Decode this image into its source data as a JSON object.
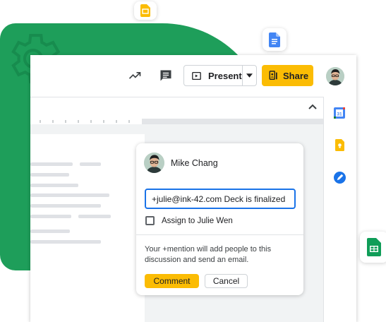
{
  "toolbar": {
    "present_label": "Present",
    "share_label": "Share"
  },
  "comment": {
    "author": "Mike Chang",
    "input_value": "+julie@ink-42.com Deck is finalized",
    "assign_label": "Assign to Julie Wen",
    "assign_checked": false,
    "helper_text": "Your +mention will add people to this discussion and send an email.",
    "comment_button": "Comment",
    "cancel_button": "Cancel"
  },
  "side_panel": {
    "calendar_day": "31",
    "apps": [
      "calendar-icon",
      "keep-icon",
      "tasks-icon"
    ]
  },
  "floating_apps": [
    "slides-icon",
    "docs-icon",
    "sheets-icon"
  ],
  "colors": {
    "accent_yellow": "#fbbc04",
    "brand_green": "#1e9e5a",
    "focus_blue": "#1a73e8"
  },
  "icons": {
    "trend": "trending-up-icon",
    "comments": "comments-icon",
    "present": "present-icon",
    "dropdown": "chevron-down-icon",
    "share": "share-icon",
    "collapse": "chevron-up-icon",
    "settings": "gear-icon"
  }
}
